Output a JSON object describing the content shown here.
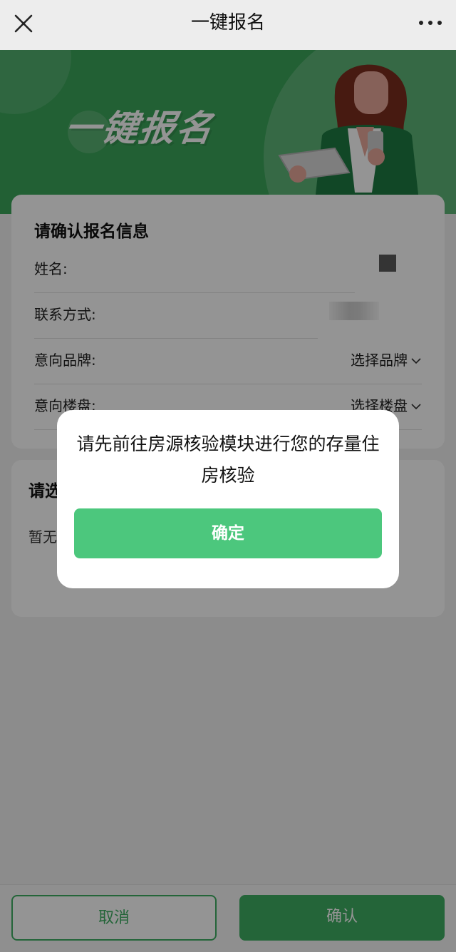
{
  "header": {
    "title": "一键报名",
    "close_icon": "close-icon",
    "more_icon": "more-icon"
  },
  "banner": {
    "title": "一键报名",
    "bg_color": "#3ba55a"
  },
  "form": {
    "title": "请确认报名信息",
    "fields": [
      {
        "label": "姓名:"
      },
      {
        "label": "联系方式:"
      },
      {
        "label": "意向品牌:",
        "select": "选择品牌"
      },
      {
        "label": "意向楼盘:",
        "select": "选择楼盘"
      }
    ]
  },
  "section2": {
    "title_visible": "请选",
    "empty_visible": "暂无"
  },
  "footer": {
    "cancel_label": "取消",
    "confirm_label": "确认",
    "accent_color": "#3fae63"
  },
  "modal": {
    "message": "请先前往房源核验模块进行您的存量住房核验",
    "ok_label": "确定",
    "button_color": "#4cc77d"
  }
}
